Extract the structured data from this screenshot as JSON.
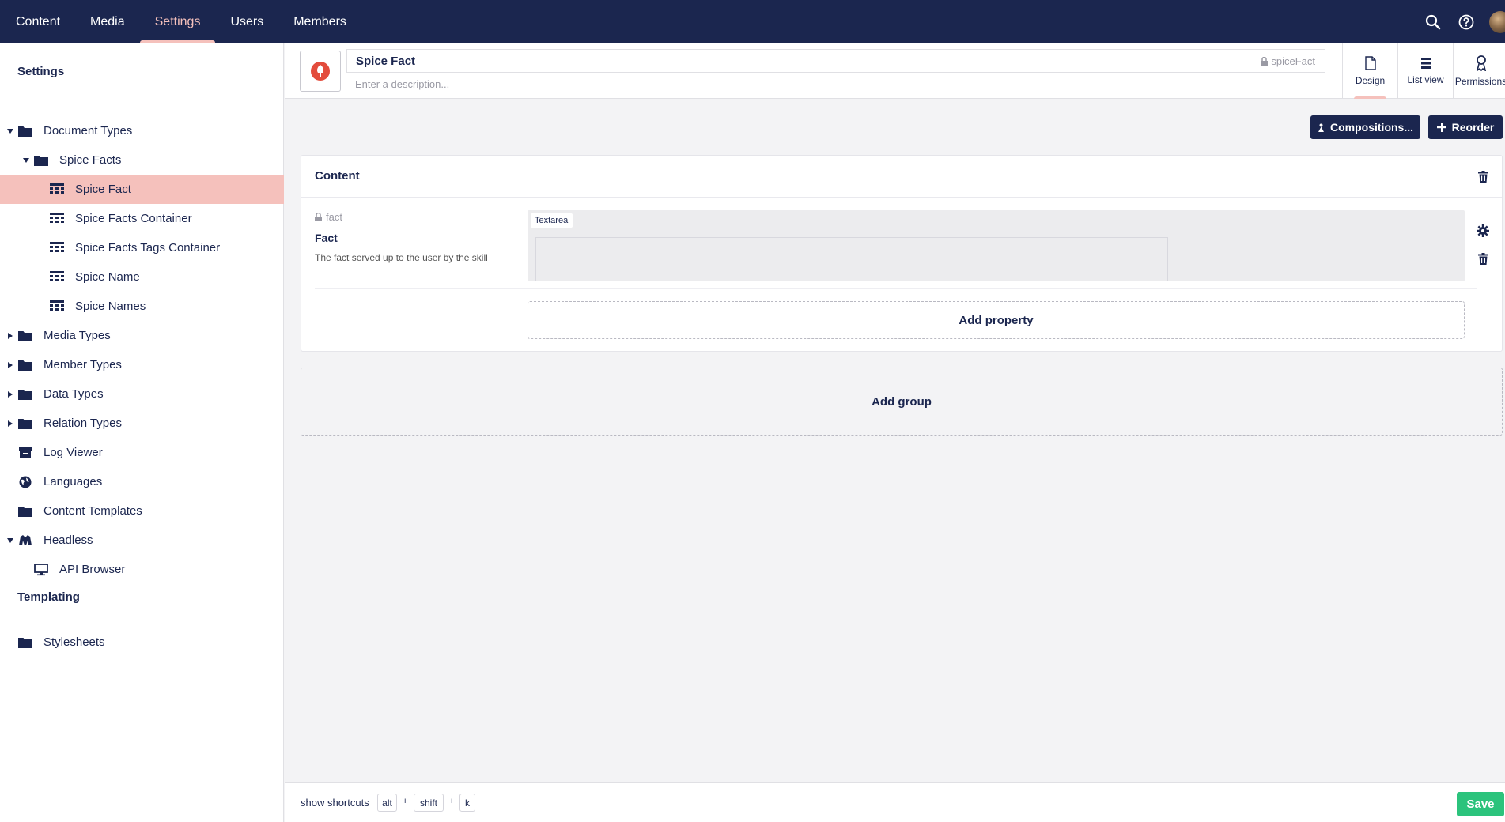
{
  "topnav": {
    "items": [
      "Content",
      "Media",
      "Settings",
      "Users",
      "Members"
    ],
    "active": "Settings",
    "icons": [
      "search-icon",
      "help-icon",
      "avatar"
    ]
  },
  "sidebar": {
    "section_settings": "Settings",
    "tree": [
      {
        "label": "Document Types",
        "icon": "folder-icon",
        "expanded": true
      },
      {
        "label": "Spice Facts",
        "icon": "folder-icon",
        "expanded": true
      },
      {
        "label": "Spice Fact",
        "icon": "doc-type-icon",
        "selected": true
      },
      {
        "label": "Spice Facts Container",
        "icon": "doc-type-icon"
      },
      {
        "label": "Spice Facts Tags Container",
        "icon": "doc-type-icon"
      },
      {
        "label": "Spice Name",
        "icon": "doc-type-icon"
      },
      {
        "label": "Spice Names",
        "icon": "doc-type-icon"
      },
      {
        "label": "Media Types",
        "icon": "folder-icon"
      },
      {
        "label": "Member Types",
        "icon": "folder-icon"
      },
      {
        "label": "Data Types",
        "icon": "folder-icon"
      },
      {
        "label": "Relation Types",
        "icon": "folder-icon"
      },
      {
        "label": "Log Viewer",
        "icon": "box-icon"
      },
      {
        "label": "Languages",
        "icon": "globe-icon"
      },
      {
        "label": "Content Templates",
        "icon": "folder-icon"
      },
      {
        "label": "Headless",
        "icon": "headless-icon",
        "expanded": true
      },
      {
        "label": "API Browser",
        "icon": "monitor-icon"
      }
    ],
    "section_templating": "Templating",
    "templating": [
      {
        "label": "Stylesheets",
        "icon": "folder-icon"
      }
    ]
  },
  "header": {
    "name": "Spice Fact",
    "alias": "spiceFact",
    "description_placeholder": "Enter a description...",
    "apps": [
      {
        "label": "Design",
        "icon": "document-icon",
        "active": true
      },
      {
        "label": "List view",
        "icon": "list-icon"
      },
      {
        "label": "Permissions",
        "icon": "permissions-icon"
      }
    ]
  },
  "toolbar": {
    "compositions_label": "Compositions...",
    "reorder_label": "Reorder"
  },
  "group": {
    "title": "Content",
    "property": {
      "alias": "fact",
      "label": "Fact",
      "description": "The fact served up to the user by the skill",
      "editor": "Textarea"
    },
    "add_property_label": "Add property"
  },
  "add_group_label": "Add group",
  "footer": {
    "shortcuts_label": "show shortcuts",
    "keys": [
      "alt",
      "shift",
      "k"
    ],
    "plus": "+",
    "save_label": "Save"
  },
  "colors": {
    "navy": "#1b264f",
    "accent_pink": "#f5c1bc",
    "save_green": "#2bc37c",
    "doc_icon_red": "#e34c3c"
  }
}
